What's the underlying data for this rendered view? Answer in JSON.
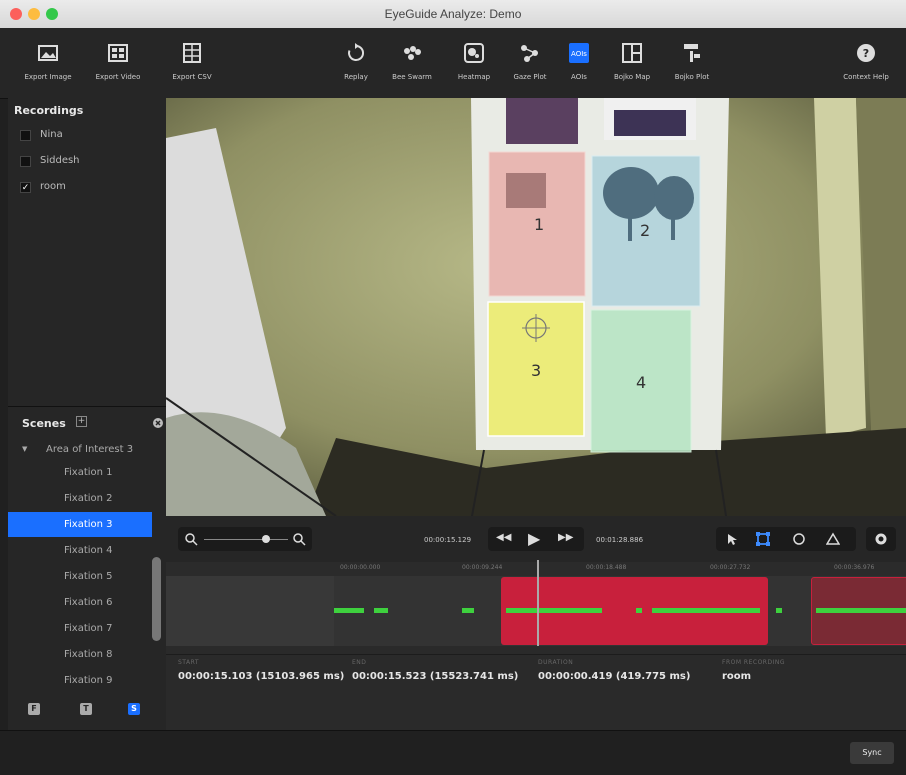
{
  "window": {
    "title": "EyeGuide Analyze: Demo"
  },
  "toolbar": {
    "export_image": "Export Image",
    "export_video": "Export Video",
    "export_csv": "Export CSV",
    "replay": "Replay",
    "bee_swarm": "Bee Swarm",
    "heatmap": "Heatmap",
    "gaze_plot": "Gaze Plot",
    "aois": "AOIs",
    "bojko_map": "Bojko Map",
    "bojko_plot": "Bojko Plot",
    "context_help": "Context Help"
  },
  "recordings": {
    "header": "Recordings",
    "items": [
      {
        "label": "Nina",
        "checked": false
      },
      {
        "label": "Siddesh",
        "checked": false
      },
      {
        "label": "room",
        "checked": true
      }
    ]
  },
  "scenes": {
    "header": "Scenes",
    "group": "Area of Interest 3",
    "items": [
      "Fixation 1",
      "Fixation 2",
      "Fixation 3",
      "Fixation 4",
      "Fixation 5",
      "Fixation 6",
      "Fixation 7",
      "Fixation 8",
      "Fixation 9"
    ],
    "selected": "Fixation 3"
  },
  "video": {
    "aoi_labels": [
      "1",
      "2",
      "3",
      "4"
    ]
  },
  "timeline": {
    "current_time": "00:00:15.129",
    "total_time": "00:01:28.886",
    "ruler": [
      "00:00:00.000",
      "00:00:09.244",
      "00:00:18.488",
      "00:00:27.732",
      "00:00:36.976"
    ]
  },
  "info": {
    "start_label": "START",
    "start_value": "00:00:15.103 (15103.965 ms)",
    "end_label": "END",
    "end_value": "00:00:15.523 (15523.741 ms)",
    "duration_label": "DURATION",
    "duration_value": "00:00:00.419 (419.775 ms)",
    "from_label": "FROM RECORDING",
    "from_value": "room"
  },
  "footer": {
    "sync": "Sync"
  },
  "colors": {
    "accent": "#1a6fff",
    "fixation": "#3ed13e",
    "selection": "#c8203c"
  }
}
